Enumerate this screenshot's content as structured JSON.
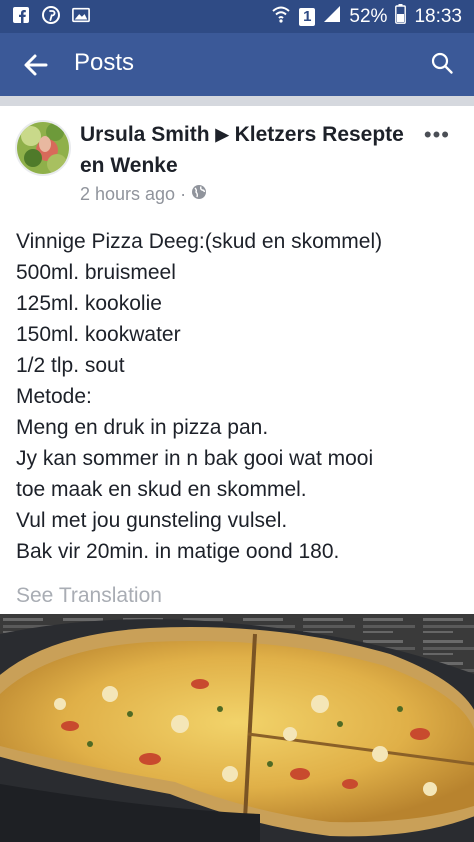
{
  "status_bar": {
    "battery_percent": "52%",
    "sim_badge": "1",
    "time": "18:33"
  },
  "app_bar": {
    "title": "Posts"
  },
  "post": {
    "author": "Ursula Smith",
    "group": "Kletzers Resepte en Wenke",
    "time_ago": "2 hours ago",
    "lines": [
      "Vinnige Pizza Deeg:(skud en skommel)",
      "500ml. bruismeel",
      "125ml. kookolie",
      "150ml. kookwater",
      "1/2 tlp. sout",
      "Metode:",
      "Meng en druk in pizza pan.",
      "Jy kan sommer in n bak gooi wat mooi",
      "toe maak en skud en skommel.",
      "Vul met jou gunsteling vulsel.",
      "Bak vir 20min. in matige oond 180."
    ],
    "see_translation": "See Translation"
  },
  "icons": [
    "facebook-icon",
    "pinterest-icon",
    "gallery-icon",
    "wifi-icon",
    "sim-icon",
    "signal-icon",
    "battery-icon",
    "back-arrow-icon",
    "search-icon",
    "more-icon",
    "globe-icon"
  ],
  "colors": {
    "app_bar": "#3b5998",
    "status_bar": "#2f4b85",
    "text": "#1d2129",
    "muted": "#90949c"
  }
}
